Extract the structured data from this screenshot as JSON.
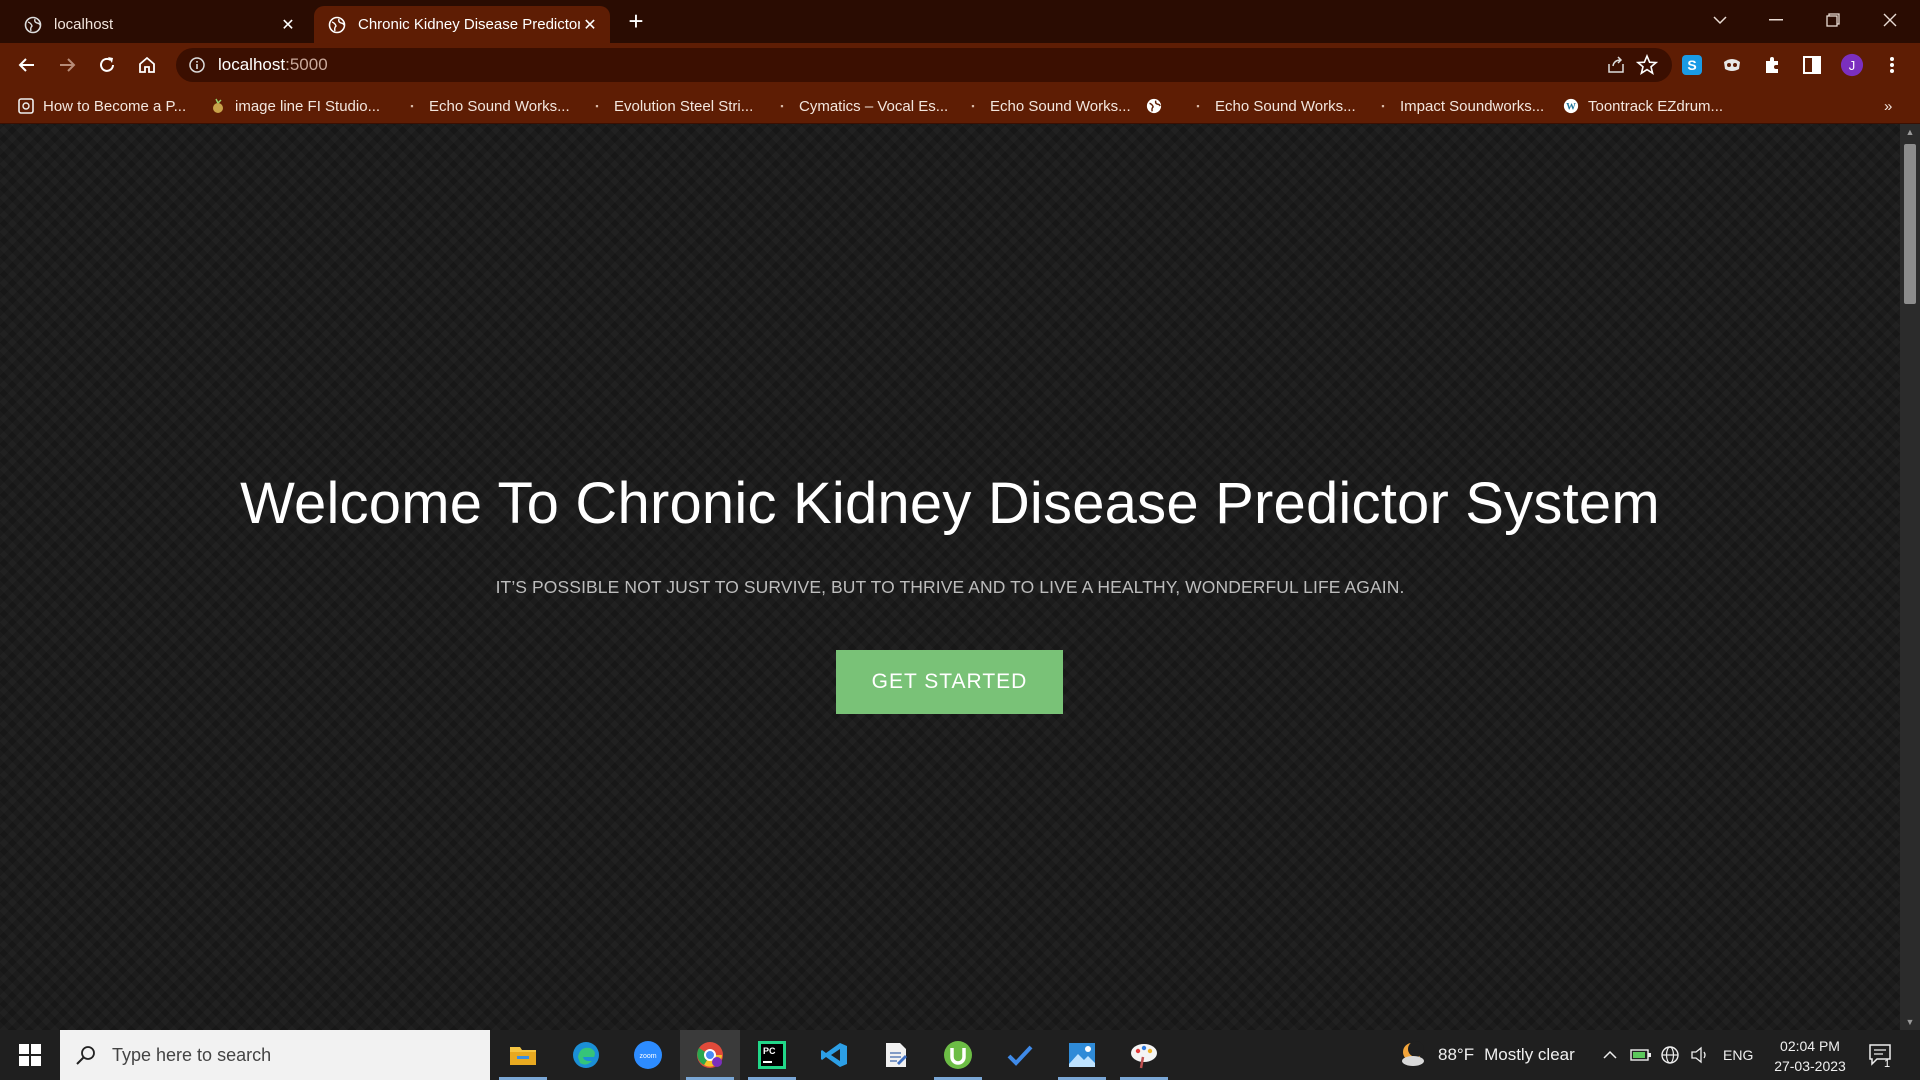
{
  "browser": {
    "tabs": [
      {
        "title": "localhost"
      },
      {
        "title": "Chronic Kidney Disease Predictor"
      }
    ],
    "new_tab": "+",
    "address": {
      "host": "localhost",
      "port": ":5000"
    },
    "profile_initial": "J",
    "bookmarks": [
      {
        "label": "How to Become a P...",
        "icon": "shield-bookmark-icon"
      },
      {
        "label": "image line FI Studio...",
        "icon": "fruit-bookmark-icon"
      },
      {
        "label": "Echo Sound Works...",
        "icon": "page-bookmark-icon"
      },
      {
        "label": "Evolution Steel Stri...",
        "icon": "page-bookmark-icon"
      },
      {
        "label": "Cymatics – Vocal Es...",
        "icon": "page-bookmark-icon"
      },
      {
        "label": "Echo Sound Works...",
        "icon": "page-bookmark-icon"
      },
      {
        "label": "",
        "icon": "globe-bookmark-icon"
      },
      {
        "label": "Echo Sound Works...",
        "icon": "page-bookmark-icon"
      },
      {
        "label": "Impact Soundworks...",
        "icon": "page-bookmark-icon"
      },
      {
        "label": "Toontrack EZdrum...",
        "icon": "wordpress-bookmark-icon"
      }
    ],
    "more_bookmarks": "»"
  },
  "page": {
    "title": "Welcome To Chronic Kidney Disease Predictor System",
    "subtitle": "IT’S POSSIBLE NOT JUST TO SURVIVE, BUT TO THRIVE AND TO LIVE A HEALTHY, WONDERFUL LIFE AGAIN.",
    "cta_label": "GET STARTED",
    "accent": "#79c277"
  },
  "taskbar": {
    "search_placeholder": "Type here to search",
    "weather": {
      "temp": "88°F",
      "condition": "Mostly clear"
    },
    "language": "ENG",
    "time": "02:04 PM",
    "date": "27-03-2023",
    "notification_count": "1"
  },
  "colors": {
    "tab_strip": "#2a0c02",
    "toolbar": "#5e1d04",
    "page_bg": "#1c1c1c"
  }
}
